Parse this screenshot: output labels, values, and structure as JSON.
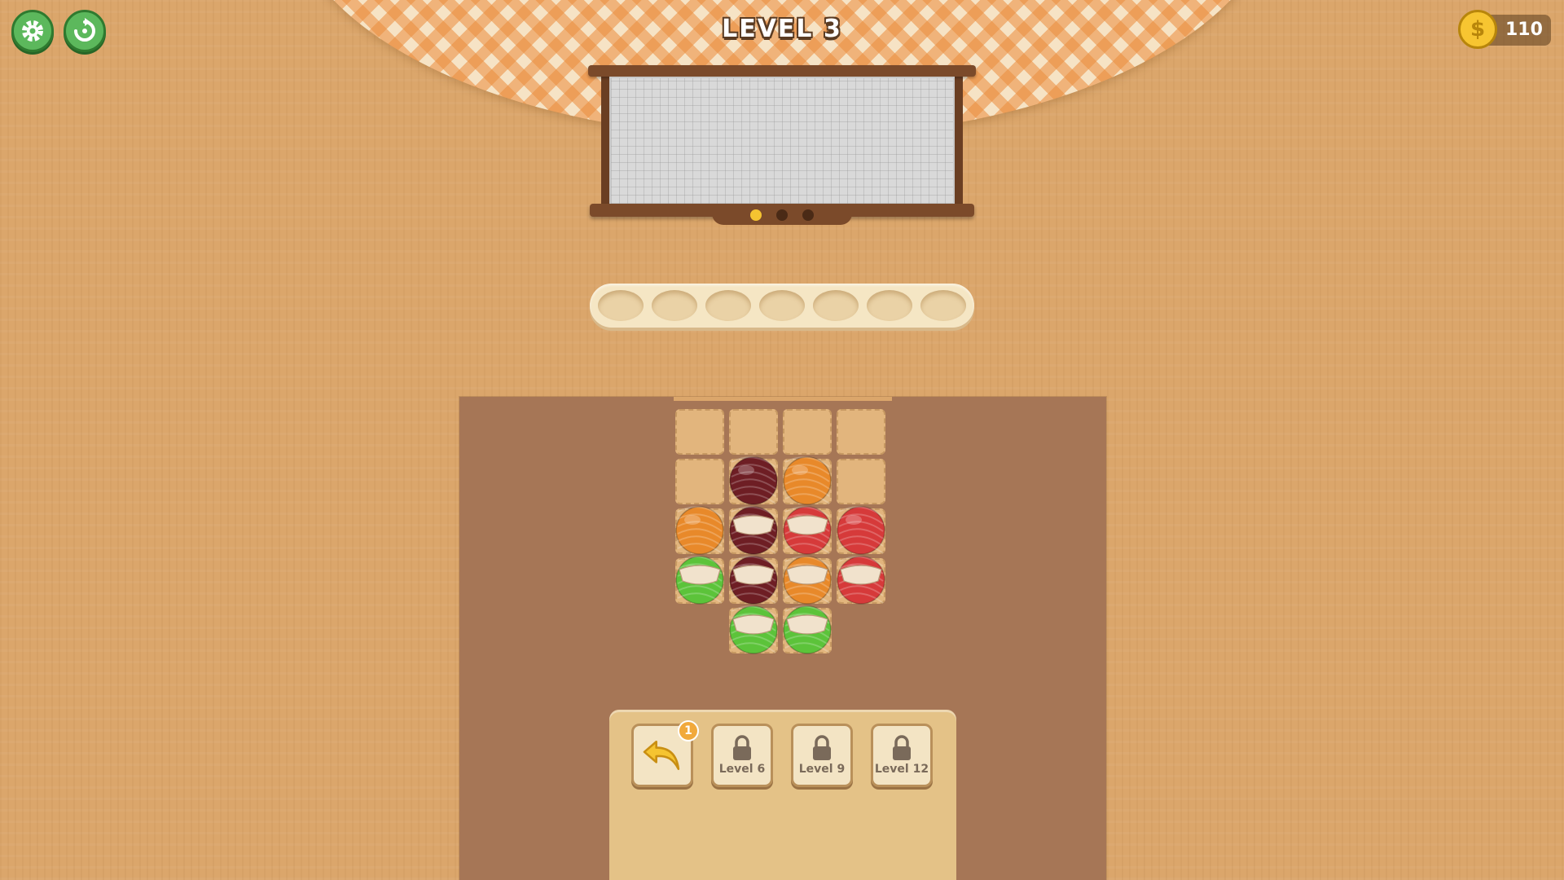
{
  "header": {
    "level_title": "LEVEL 3",
    "coins": "110",
    "coin_symbol": "$",
    "settings_icon": "gear-icon",
    "restart_icon": "restart-icon"
  },
  "progress": {
    "dots_total": 3,
    "dots_filled": 1
  },
  "holder": {
    "slots_total": 7,
    "slots_filled": 0
  },
  "board": {
    "columns": 4,
    "grid": [
      [
        "empty",
        "empty",
        "empty",
        "empty"
      ],
      [
        "empty",
        "maroon",
        "orange",
        "empty"
      ],
      [
        "orange",
        "maroon-wrapped",
        "red-wrapped",
        "red"
      ],
      [
        "green-wrapped",
        "maroon-wrapped",
        "orange-wrapped",
        "red-wrapped"
      ],
      [
        null,
        "green-wrapped",
        "green-wrapped",
        null
      ]
    ]
  },
  "tools": {
    "undo": {
      "icon": "undo-arrow-icon",
      "count": "1"
    },
    "locked": [
      {
        "label": "Level 6",
        "icon": "lock-icon"
      },
      {
        "label": "Level 9",
        "icon": "lock-icon"
      },
      {
        "label": "Level 12",
        "icon": "lock-icon"
      }
    ]
  },
  "colors": {
    "maroon": "#6e1e24",
    "orange": "#e8892a",
    "red": "#d63a3a",
    "green": "#5cc33a",
    "ui_green": "#5cb85c",
    "coin_gold": "#f7c531"
  }
}
